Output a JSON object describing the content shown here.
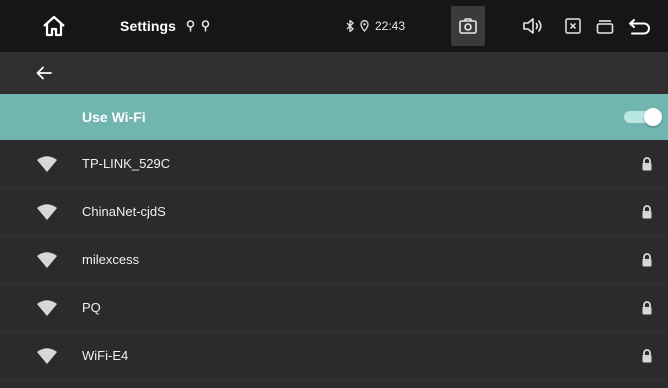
{
  "statusbar": {
    "title": "Settings",
    "time": "22:43"
  },
  "wifi": {
    "toggle_label": "Use Wi-Fi",
    "enabled": true
  },
  "networks": [
    {
      "name": "TP-LINK_529C",
      "secured": true
    },
    {
      "name": "ChinaNet-cjdS",
      "secured": true
    },
    {
      "name": "milexcess",
      "secured": true
    },
    {
      "name": "PQ",
      "secured": true
    },
    {
      "name": "WiFi-E4",
      "secured": true
    }
  ],
  "colors": {
    "accent": "#71b5b0",
    "statusbar": "#161616",
    "background": "#2b2b2b"
  },
  "icons": {
    "home": "home-icon",
    "location": "location-pin-icon",
    "bluetooth": "bluetooth-icon",
    "camera": "camera-icon",
    "volume": "volume-icon",
    "close": "close-box-icon",
    "recents": "recents-icon",
    "back": "back-icon",
    "wifi": "wifi-icon",
    "lock": "lock-icon"
  }
}
